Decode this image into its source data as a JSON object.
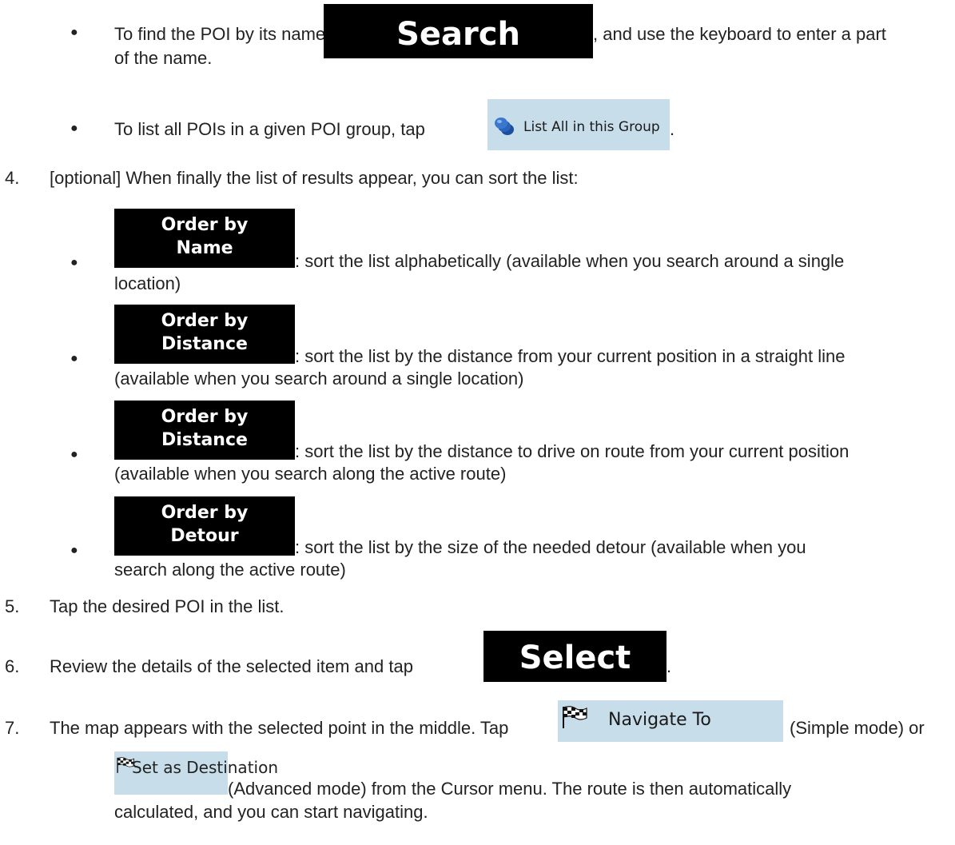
{
  "steps": {
    "bullet_search": {
      "before": "To find the POI by its name, tap",
      "after": ", and use the keyboard to enter a part",
      "cont": "of the name.",
      "button": "Search"
    },
    "bullet_listall": {
      "before": "To list all POIs in a given POI group, tap",
      "after": ".",
      "button": "List All in this Group",
      "icon": "poi-group-icon"
    },
    "step4": {
      "number": "4.",
      "text": "[optional] When finally the list of results appear, you can sort the list:",
      "order_name": {
        "line1": "Order by",
        "line2": "Name",
        "after": ": sort the list alphabetically (available when you search around a single",
        "cont": "location)"
      },
      "order_distance1": {
        "line1": "Order by",
        "line2": "Distance",
        "after": ": sort the list by the distance from your current position in a straight line",
        "cont": "(available when you search around a single location)"
      },
      "order_distance2": {
        "line1": "Order by",
        "line2": "Distance",
        "after": ": sort the list by the distance to drive on route from your current position",
        "cont": "(available when you search along the active route)"
      },
      "order_detour": {
        "line1": "Order by",
        "line2": "Detour",
        "after": ": sort the list by the size of the needed detour (available when you",
        "cont": "search along the active route)"
      }
    },
    "step5": {
      "number": "5.",
      "text": "Tap the desired POI in the list."
    },
    "step6": {
      "number": "6.",
      "before": "Review the details of the selected item and tap",
      "after": ".",
      "button": "Select"
    },
    "step7": {
      "number": "7.",
      "before": "The map appears with the selected point in the middle. Tap",
      "navigate_button": "Navigate To",
      "middle": "(Simple mode) or",
      "destination_button": "Set as Destination",
      "after": "(Advanced mode) from the Cursor menu. The route is then automatically",
      "cont": "calculated, and you can start navigating.",
      "icon": "checkered-flag-icon"
    }
  },
  "colors": {
    "text": "#222222",
    "black_button": "#000000",
    "blue_button": "#c7dde9"
  }
}
